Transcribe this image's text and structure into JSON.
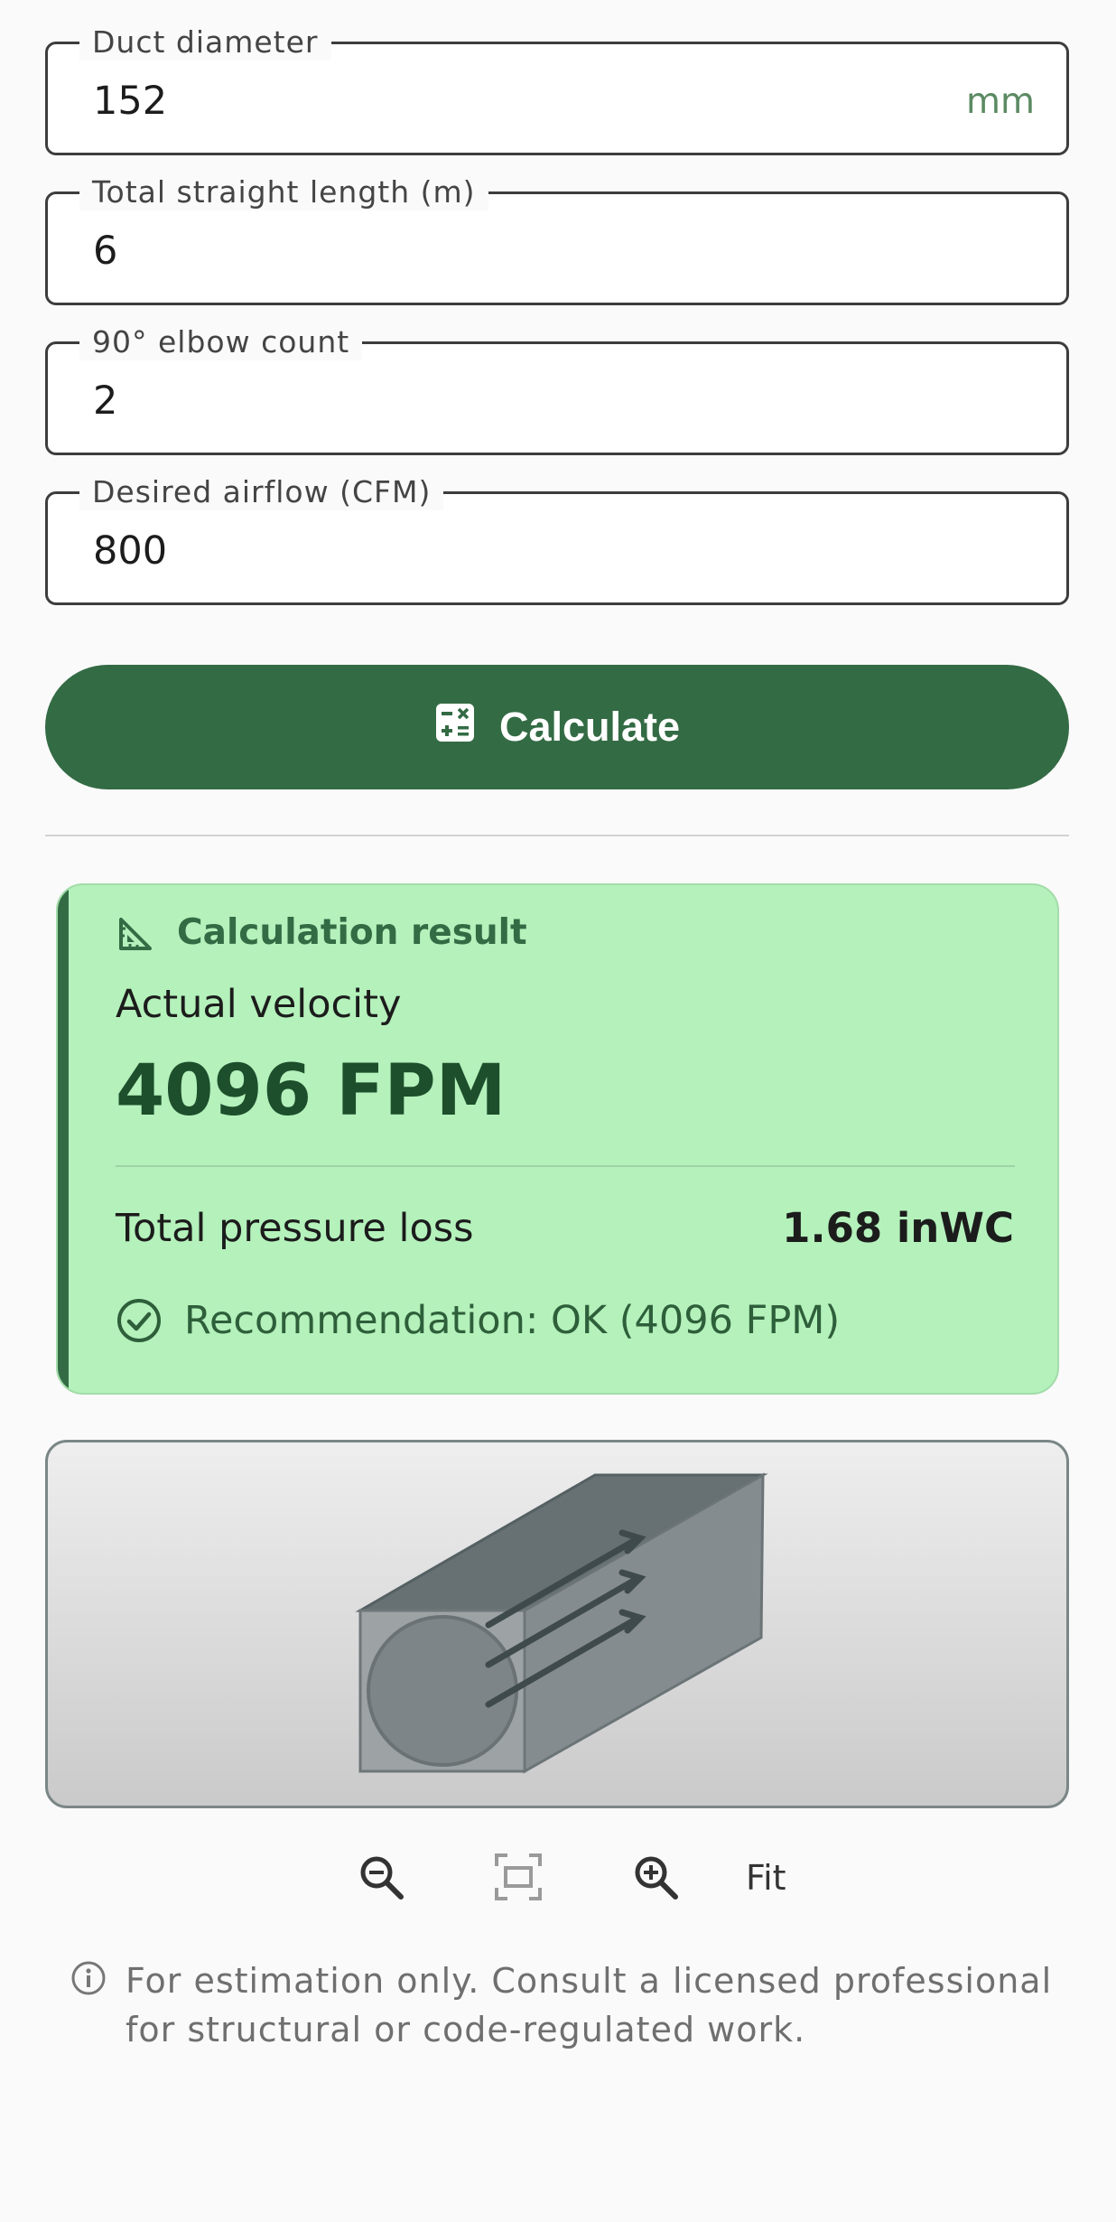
{
  "form": {
    "duct_diameter": {
      "label": "Duct diameter",
      "value": "152",
      "suffix": "mm"
    },
    "straight_length": {
      "label": "Total straight length (m)",
      "value": "6"
    },
    "elbow_count": {
      "label": "90° elbow count",
      "value": "2"
    },
    "airflow": {
      "label": "Desired airflow (CFM)",
      "value": "800"
    }
  },
  "calculate_button": {
    "label": "Calculate",
    "icon": "calculator-icon"
  },
  "result": {
    "title": "Calculation result",
    "title_icon": "set-square-icon",
    "velocity_label": "Actual velocity",
    "velocity_value": "4096 FPM",
    "pressure_loss_label": "Total pressure loss",
    "pressure_loss_value": "1.68 inWC",
    "recommendation": "Recommendation: OK (4096 FPM)",
    "recommendation_icon": "check-circle-icon",
    "colors": {
      "card_bg": "#b4f1bb",
      "accent": "#336b44",
      "value": "#1d4f2c"
    }
  },
  "viewer": {
    "illustration": "duct-3d-illustration",
    "controls": {
      "zoom_out_icon": "zoom-out-icon",
      "fit_frame_icon": "fit-frame-icon",
      "zoom_in_icon": "zoom-in-icon",
      "fit_label": "Fit"
    }
  },
  "disclaimer": {
    "icon": "info-icon",
    "text": "For estimation only. Consult a licensed professional for structural or code-regulated work."
  }
}
